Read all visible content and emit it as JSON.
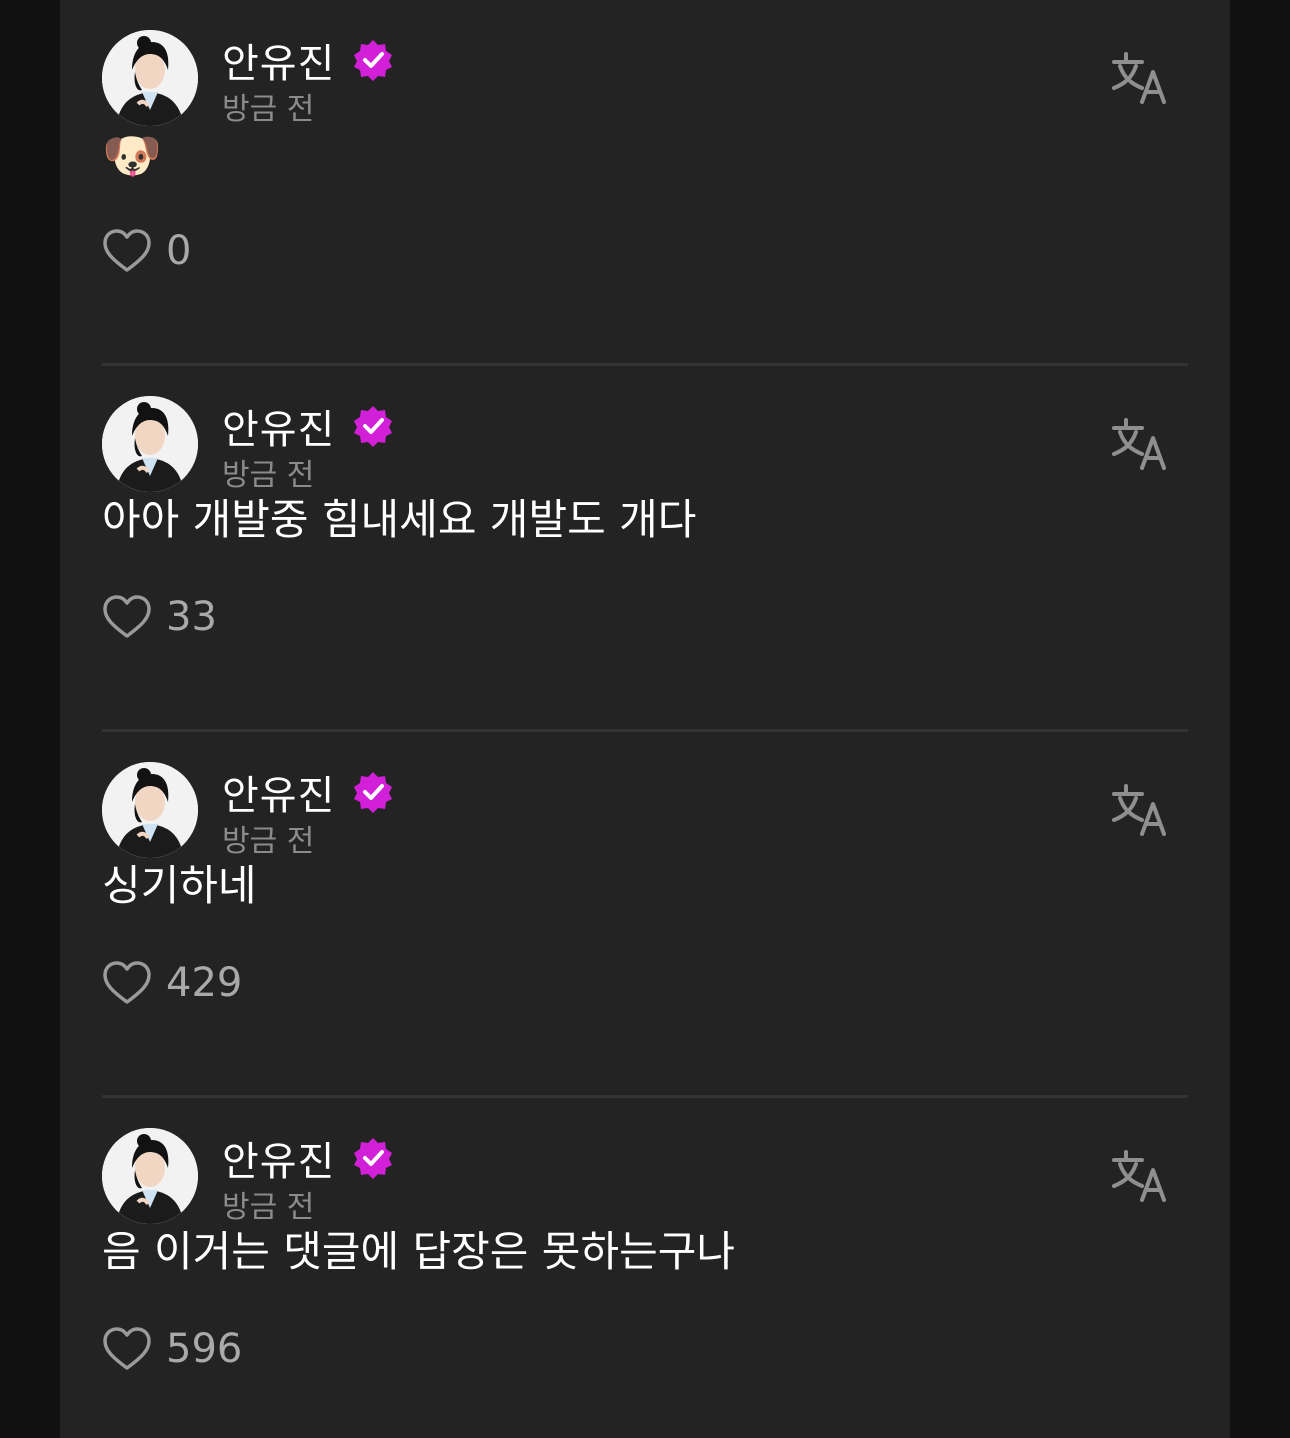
{
  "posts": [
    {
      "author": "안유진",
      "time": "방금 전",
      "content": "🐶",
      "likes": "0"
    },
    {
      "author": "안유진",
      "time": "방금 전",
      "content": "아아 개발중 힘내세요 개발도 개다",
      "likes": "33"
    },
    {
      "author": "안유진",
      "time": "방금 전",
      "content": "싱기하네",
      "likes": "429"
    },
    {
      "author": "안유진",
      "time": "방금 전",
      "content": "음 이거는 댓글에 답장은 못하는구나",
      "likes": "596"
    }
  ],
  "colors": {
    "background": "#111111",
    "panel": "#232323",
    "verified_badge": "#d21fd8",
    "muted_text": "#8b8b8b"
  },
  "icons": {
    "verified": "verified-badge-icon",
    "translate": "translate-icon",
    "like": "heart-outline-icon"
  }
}
